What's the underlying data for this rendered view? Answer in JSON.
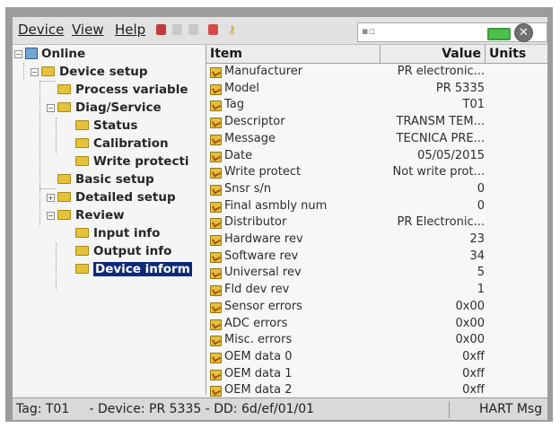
{
  "menubar": {
    "menus": [
      "Device",
      "View",
      "Help"
    ]
  },
  "status_field": {
    "signal_icon": "signal-icon",
    "battery_icon": "battery-icon",
    "close_icon": "close-icon"
  },
  "tree": {
    "items": [
      {
        "label": "Online"
      },
      {
        "label": "Device setup"
      },
      {
        "label": "Process variable"
      },
      {
        "label": "Diag/Service"
      },
      {
        "label": "Status"
      },
      {
        "label": "Calibration"
      },
      {
        "label": "Write protecti"
      },
      {
        "label": "Basic setup"
      },
      {
        "label": "Detailed setup"
      },
      {
        "label": "Review"
      },
      {
        "label": "Input info"
      },
      {
        "label": "Output info"
      },
      {
        "label": "Device inform",
        "selected": true
      }
    ]
  },
  "list": {
    "columns": [
      "Item",
      "Value",
      "Units"
    ],
    "rows": [
      {
        "item": "Manufacturer",
        "value": "PR electronic..."
      },
      {
        "item": "Model",
        "value": "PR 5335"
      },
      {
        "item": "Tag",
        "value": "T01"
      },
      {
        "item": "Descriptor",
        "value": "TRANSM TEM..."
      },
      {
        "item": "Message",
        "value": "TECNICA PRE..."
      },
      {
        "item": "Date",
        "value": "05/05/2015"
      },
      {
        "item": "Write protect",
        "value": "Not write prot..."
      },
      {
        "item": "Snsr s/n",
        "value": "0"
      },
      {
        "item": "Final asmbly num",
        "value": "0"
      },
      {
        "item": "Distributor",
        "value": "PR Electronic..."
      },
      {
        "item": "Hardware rev",
        "value": "23"
      },
      {
        "item": "Software rev",
        "value": "34"
      },
      {
        "item": "Universal rev",
        "value": "5"
      },
      {
        "item": "Fld dev rev",
        "value": "1"
      },
      {
        "item": "Sensor errors",
        "value": "0x00"
      },
      {
        "item": "ADC errors",
        "value": "0x00"
      },
      {
        "item": "Misc. errors",
        "value": "0x00"
      },
      {
        "item": "OEM data 0",
        "value": "0xff"
      },
      {
        "item": "OEM data 1",
        "value": "0xff"
      },
      {
        "item": "OEM data 2",
        "value": "0xff"
      }
    ]
  },
  "statusbar": {
    "info": "Tag: T01     - Device: PR 5335 - DD: 6d/ef/01/01",
    "hart": "HART Msg"
  },
  "colors": {
    "selection": "#102a7a",
    "folder": "#e5c23a",
    "battery": "#4cc04c"
  }
}
